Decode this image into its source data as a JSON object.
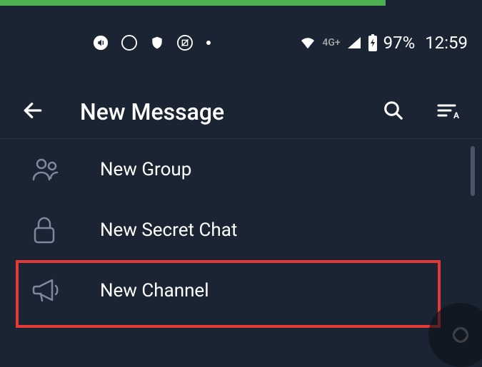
{
  "statusBar": {
    "networkLabel": "4G+",
    "batteryPercent": "97%",
    "time": "12:59"
  },
  "header": {
    "title": "New Message"
  },
  "menu": {
    "items": [
      {
        "label": "New Group"
      },
      {
        "label": "New Secret Chat"
      },
      {
        "label": "New Channel"
      }
    ]
  }
}
